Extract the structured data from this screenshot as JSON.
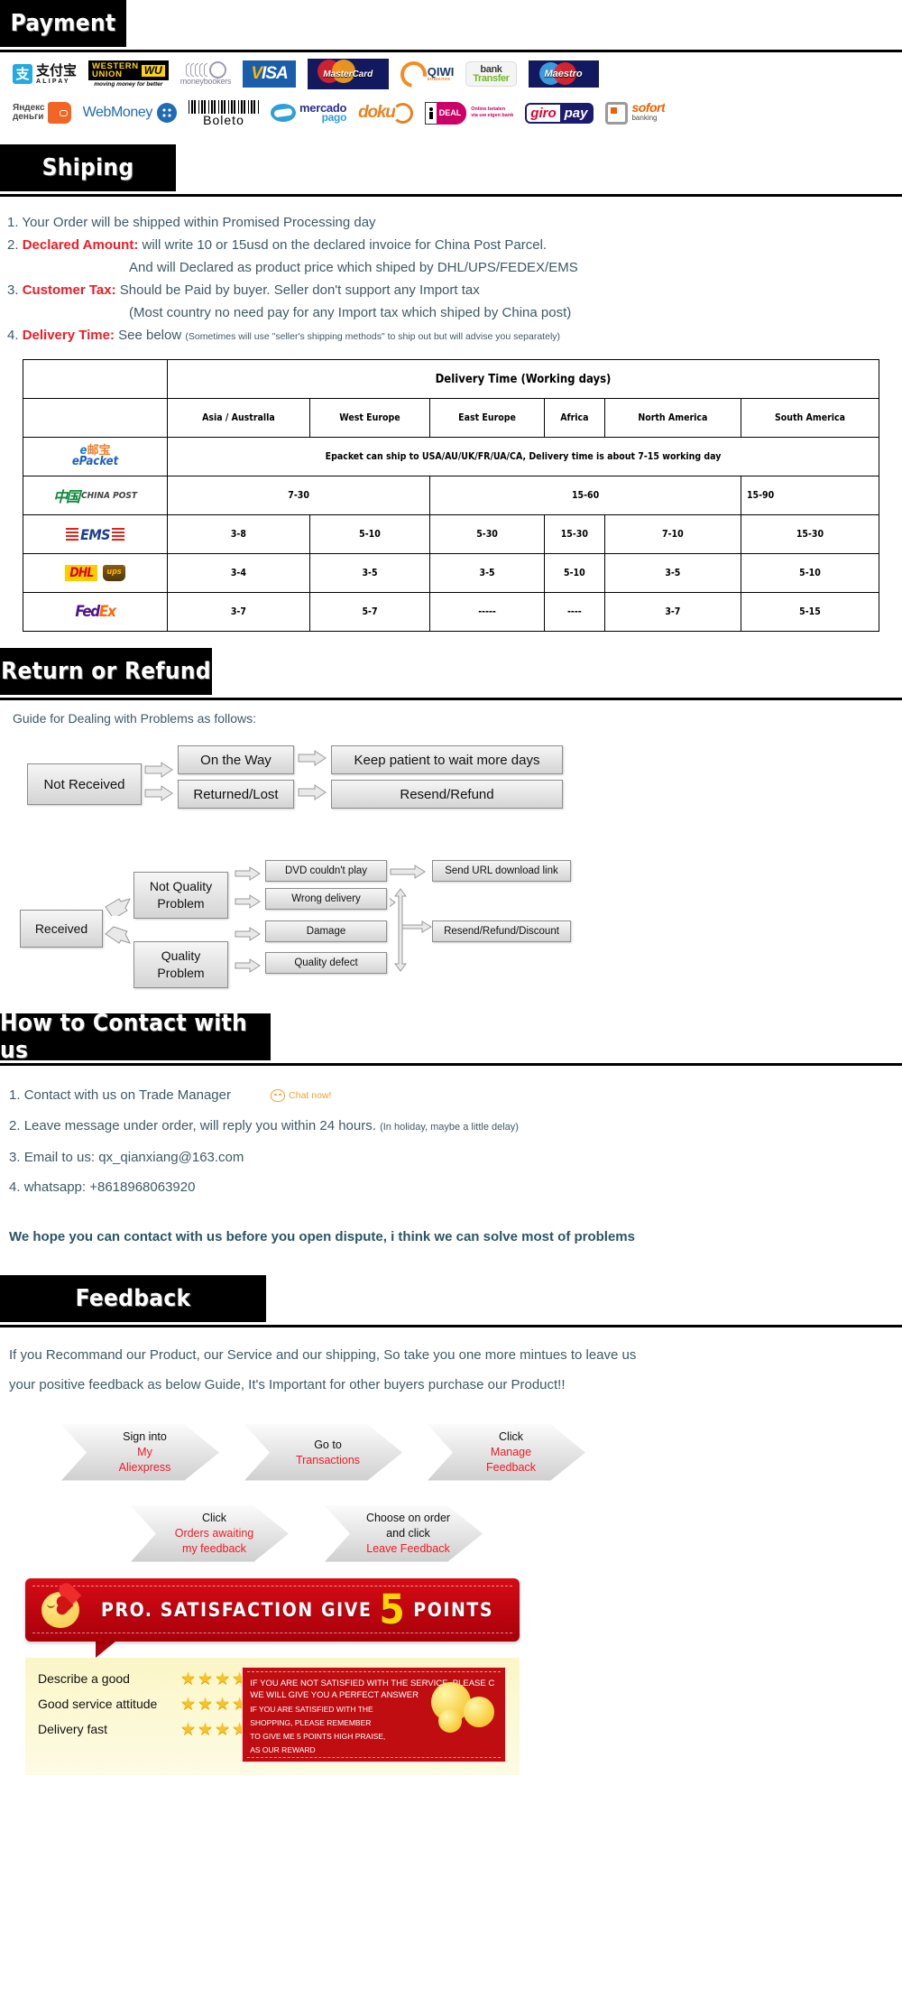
{
  "sections": {
    "payment": {
      "title": "Payment"
    },
    "shipping": {
      "title": "Shiping"
    },
    "return": {
      "title": "Return or Refund"
    },
    "contact": {
      "title": "How to Contact with us"
    },
    "feedback": {
      "title": "Feedback"
    }
  },
  "payment_methods": {
    "row1": [
      {
        "name": "alipay",
        "cn": "支付宝",
        "en": "ALIPAY",
        "mark": "支"
      },
      {
        "name": "western-union",
        "line1": "WESTERN",
        "line2": "UNION",
        "badge": "WU",
        "tagline": "moving money for better"
      },
      {
        "name": "moneybookers",
        "label": "moneybookers"
      },
      {
        "name": "visa",
        "label": "VISA"
      },
      {
        "name": "mastercard",
        "label": "MasterCard"
      },
      {
        "name": "qiwi",
        "label": "QIWI",
        "sub": "кошелек"
      },
      {
        "name": "bank-transfer",
        "line1": "bank",
        "line2": "Transfer"
      },
      {
        "name": "maestro",
        "label": "Maestro"
      }
    ],
    "row2": [
      {
        "name": "yandex-money",
        "line1": "Яндекс",
        "line2": "деньги"
      },
      {
        "name": "webmoney",
        "label": "WebMoney"
      },
      {
        "name": "boleto",
        "label": "Boleto"
      },
      {
        "name": "mercado-pago",
        "line1": "mercado",
        "line2": "pago"
      },
      {
        "name": "doku",
        "label": "doku"
      },
      {
        "name": "ideal",
        "label": "DEAL",
        "sub1": "Online betalen",
        "sub2": "via uw eigen bank"
      },
      {
        "name": "giropay",
        "line1": "giro",
        "line2": "pay"
      },
      {
        "name": "sofort",
        "line1": "sofort",
        "line2": "banking"
      }
    ]
  },
  "shipping": {
    "items": [
      {
        "num": "1.",
        "bold": "",
        "text": "Your Order will be shipped within Promised Processing day"
      },
      {
        "num": "2.",
        "bold": "Declared Amount:",
        "text": "will write 10 or 15usd on the declared invoice for China Post Parcel."
      },
      {
        "num": "",
        "bold": "",
        "text": "And will Declared as product price which shiped by DHL/UPS/FEDEX/EMS"
      },
      {
        "num": "3.",
        "bold": "Customer Tax:",
        "text": "Should be Paid by buyer. Seller don't support any Import tax"
      },
      {
        "num": "",
        "bold": "",
        "text": "(Most country no need pay for any Import tax which shiped by China post)"
      },
      {
        "num": "4.",
        "bold": "Delivery Time:",
        "text": "See below",
        "small": "(Sometimes will use \"seller's shipping methods\" to ship out but will advise you separately)"
      }
    ]
  },
  "delivery_table": {
    "title": "Delivery Time (Working days)",
    "regions": [
      "Asia / Australla",
      "West Europe",
      "East Europe",
      "Africa",
      "North America",
      "South America"
    ],
    "rows": [
      {
        "carrier": "ePacket",
        "spanned": true,
        "text": "Epacket can ship to USA/AU/UK/FR/UA/CA, Delivery time is about 7-15 working day"
      },
      {
        "carrier": "CHINA POST",
        "merged": true,
        "values": [
          "7-30",
          "15-60",
          "15-90"
        ]
      },
      {
        "carrier": "EMS",
        "values": [
          "3-8",
          "5-10",
          "5-30",
          "15-30",
          "7-10",
          "15-30"
        ]
      },
      {
        "carrier": "DHL / ups",
        "values": [
          "3-4",
          "3-5",
          "3-5",
          "5-10",
          "3-5",
          "5-10"
        ]
      },
      {
        "carrier": "FedEx",
        "values": [
          "3-7",
          "5-7",
          "-----",
          "----",
          "3-7",
          "5-15"
        ]
      }
    ]
  },
  "refund_flow": {
    "guide": "Guide for Dealing with Problems as follows:",
    "not_received": "Not Received",
    "on_the_way": "On the Way",
    "returned_lost": "Returned/Lost",
    "keep_patient": "Keep patient to wait more days",
    "resend_refund": "Resend/Refund",
    "received": "Received",
    "not_quality_l1": "Not Quality",
    "not_quality_l2": "Problem",
    "quality_l1": "Quality",
    "quality_l2": "Problem",
    "dvd": "DVD couldn't play",
    "wrong_delivery": "Wrong delivery",
    "damage": "Damage",
    "quality_defect": "Quality defect",
    "send_url": "Send URL download link",
    "resend_discount": "Resend/Refund/Discount"
  },
  "contact": {
    "items": [
      {
        "num": "1.",
        "text": "Contact with us on Trade Manager",
        "chat": "Chat now!"
      },
      {
        "num": "2.",
        "text": "Leave message under order, will reply you within 24 hours.",
        "note": "(In holiday, maybe a little delay)"
      },
      {
        "num": "3.",
        "text": "Email to us: qx_qianxiang@163.com"
      },
      {
        "num": "4.",
        "text": "whatsapp: +8618968063920"
      }
    ],
    "cta": "We hope you can contact with us before you open dispute, i think we can solve most of problems"
  },
  "feedback": {
    "line1": "If you Recommand our Product, our Service and our shipping, So take you one more mintues to leave us",
    "line2": "your positive feedback as below Guide, It's Important for other buyers purchase our Product!!",
    "steps_row1": [
      {
        "top": "Sign into",
        "red1": "My",
        "red2": "Aliexpress"
      },
      {
        "top": "Go to",
        "red1": "Transactions",
        "red2": ""
      },
      {
        "top": "Click",
        "red1": "Manage",
        "red2": "Feedback"
      }
    ],
    "steps_row2": [
      {
        "top": "Click",
        "red1": "Orders awaiting",
        "red2": "my feedback"
      },
      {
        "top": "Choose on order",
        "top2": "and click",
        "red1": "Leave Feedback",
        "red2": ""
      }
    ],
    "banner": {
      "text1": "PRO. SATISFACTION  GIVE",
      "number": "5",
      "text2": "POINTS"
    },
    "ratings": [
      {
        "label": "Describe a good",
        "stars": 5
      },
      {
        "label": "Good service attitude",
        "stars": 5
      },
      {
        "label": "Delivery fast",
        "stars": 5
      }
    ],
    "note": {
      "l1": "IF YOU ARE NOT SATISFIED WITH THE SERVICE, PLEASE C",
      "l2": "WE WILL GIVE YOU A PERFECT ANSWER",
      "l3": "IF YOU ARE SATISFIED WITH THE",
      "l4": "SHOPPING, PLEASE REMEMBER",
      "l5": "TO GIVE ME 5 POINTS HIGH PRAISE,",
      "l6": "AS OUR REWARD"
    }
  },
  "colors": {
    "header_bg": "#000000",
    "body_text": "#3d5a66",
    "red": "#ee1c25",
    "banner_red": "#c00d11",
    "star": "#f6c426"
  }
}
